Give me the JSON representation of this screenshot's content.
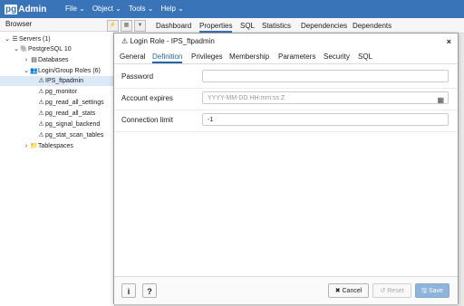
{
  "app": {
    "logo_pg": "pg",
    "logo_rest": "Admin"
  },
  "menu": [
    {
      "label": "File ⌄"
    },
    {
      "label": "Object ⌄"
    },
    {
      "label": "Tools ⌄"
    },
    {
      "label": "Help ⌄"
    }
  ],
  "browser": {
    "title": "Browser",
    "tree": [
      {
        "label": "Servers (1)",
        "chevron": "⌄",
        "icon": "☰"
      },
      {
        "label": "PostgreSQL 10",
        "chevron": "⌄",
        "icon": "🐘"
      },
      {
        "label": "Databases",
        "chevron": "›",
        "icon": "▤"
      },
      {
        "label": "Login/Group Roles (6)",
        "chevron": "⌄",
        "icon": "👥"
      },
      {
        "label": "IPS_ftpadmin",
        "chevron": "",
        "icon": "⚠"
      },
      {
        "label": "pg_monitor",
        "chevron": "",
        "icon": "⚠"
      },
      {
        "label": "pg_read_all_settings",
        "chevron": "",
        "icon": "⚠"
      },
      {
        "label": "pg_read_all_stats",
        "chevron": "",
        "icon": "⚠"
      },
      {
        "label": "pg_signal_backend",
        "chevron": "",
        "icon": "⚠"
      },
      {
        "label": "pg_stat_scan_tables",
        "chevron": "",
        "icon": "⚠"
      },
      {
        "label": "Tablespaces",
        "chevron": "›",
        "icon": "📁"
      }
    ]
  },
  "main_tabs": [
    {
      "label": "Dashboard"
    },
    {
      "label": "Properties"
    },
    {
      "label": "SQL"
    },
    {
      "label": "Statistics"
    },
    {
      "label": "Dependencies"
    },
    {
      "label": "Dependents"
    }
  ],
  "dialog": {
    "title": "Login Role - IPS_ftpadmin",
    "close": "×",
    "tabs": [
      {
        "label": "General"
      },
      {
        "label": "Definition"
      },
      {
        "label": "Privileges"
      },
      {
        "label": "Membership"
      },
      {
        "label": "Parameters"
      },
      {
        "label": "Security"
      },
      {
        "label": "SQL"
      }
    ],
    "fields": {
      "password": {
        "label": "Password",
        "value": ""
      },
      "account_expires": {
        "label": "Account expires",
        "placeholder": "YYYY-MM-DD HH:mm:ss Z"
      },
      "connection_limit": {
        "label": "Connection limit",
        "value": "-1"
      }
    },
    "footer": {
      "info": "i",
      "help": "?",
      "cancel": "✖ Cancel",
      "reset": "↺ Reset",
      "save": "🖫 Save"
    }
  },
  "colors": {
    "accent": "#3a74b8",
    "active_tab": "#2a62a8",
    "save_button": "#8fb3d9"
  }
}
